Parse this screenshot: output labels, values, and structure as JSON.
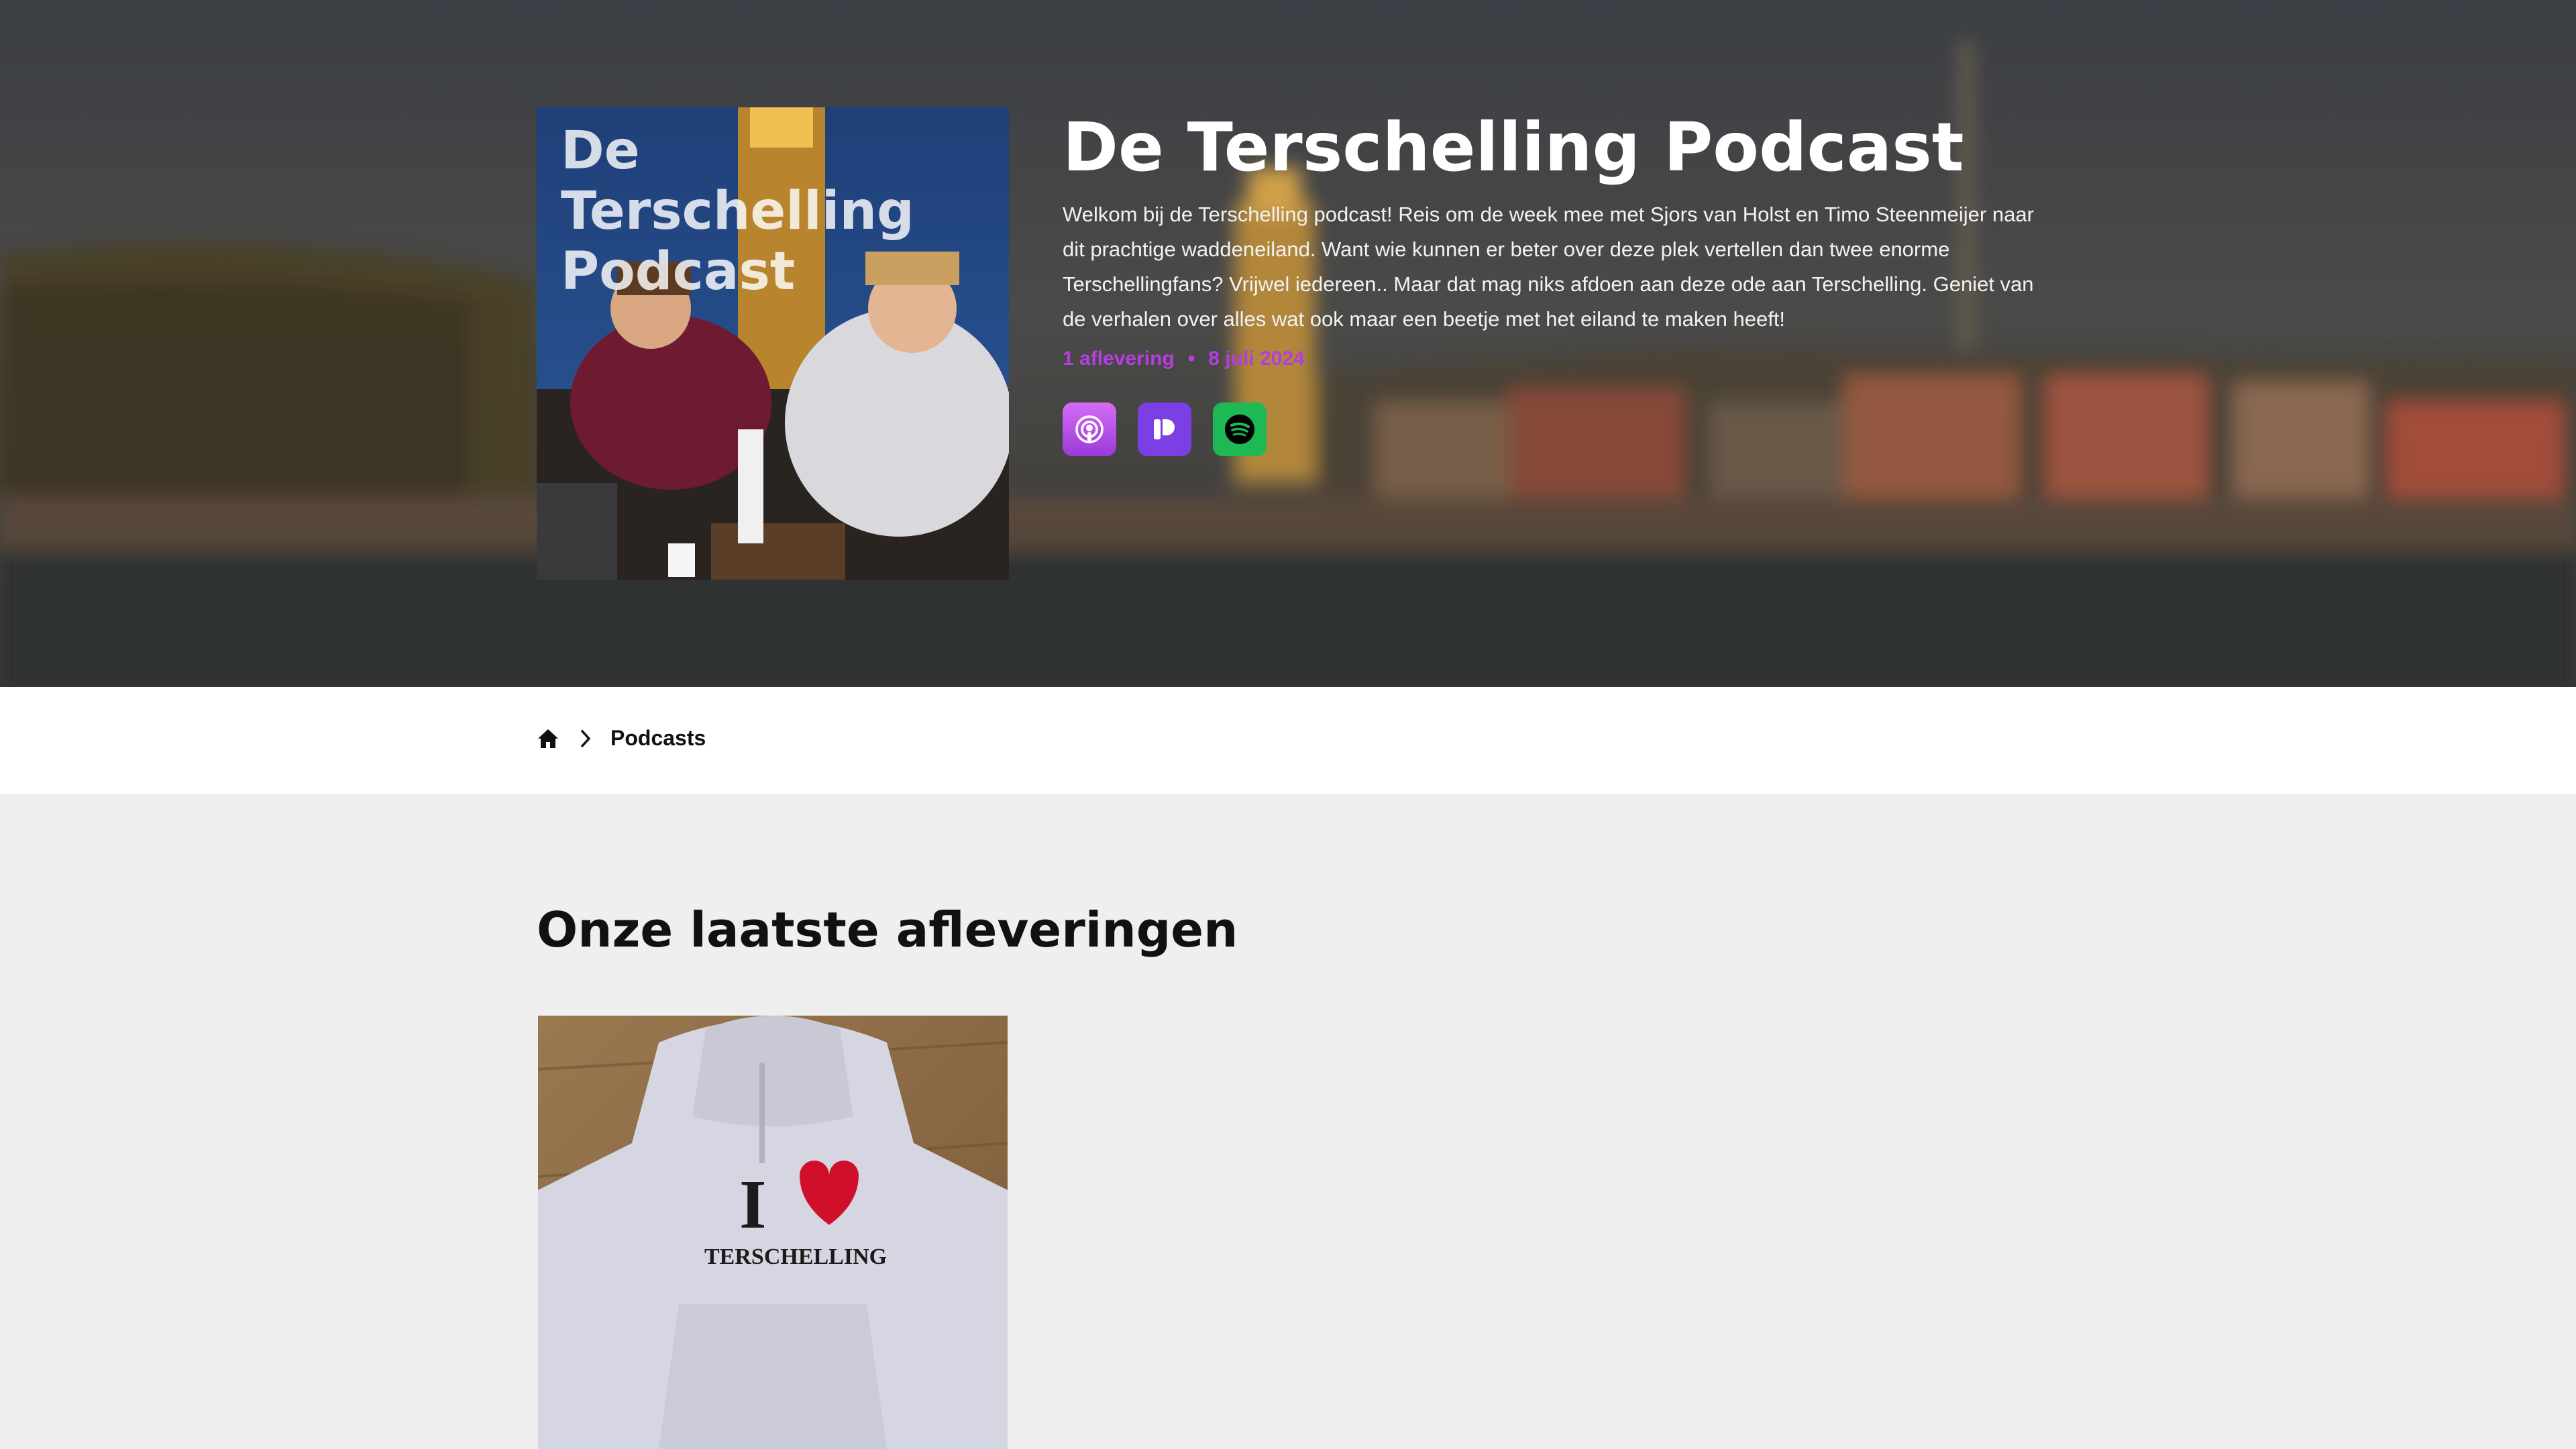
{
  "podcast": {
    "cover_title_lines": [
      "De",
      "Terschelling",
      "Podcast"
    ],
    "title": "De Terschelling Podcast",
    "description": "Welkom bij de Terschelling podcast! Reis om de week mee met Sjors van Holst en Timo Steenmeijer naar dit prachtige waddeneiland. Want wie kunnen er beter over deze plek vertellen dan twee enorme Terschellingfans? Vrijwel iedereen.. Maar dat mag niks afdoen aan deze ode aan Terschelling. Geniet van de verhalen over alles wat ook maar een beetje met het eiland te maken heeft!",
    "episode_count": "1 aflevering",
    "date": "8 juli 2024",
    "meta_separator": "•",
    "platforms": [
      {
        "name": "Apple Podcasts",
        "icon": "apple-podcasts-icon",
        "color": "#b94de8"
      },
      {
        "name": "Podimo",
        "icon": "podimo-icon",
        "color": "#7b3fe4"
      },
      {
        "name": "Spotify",
        "icon": "spotify-icon",
        "color": "#1db954"
      }
    ]
  },
  "breadcrumb": {
    "home_icon": "home-icon",
    "separator_icon": "chevron-right-icon",
    "current": "Podcasts"
  },
  "episodes_section": {
    "title": "Onze laatste afleveringen",
    "episodes": [
      {
        "image_text_top": "I",
        "image_text_bottom": "TERSCHELLING"
      }
    ]
  },
  "colors": {
    "accent": "#b53ee0",
    "page_background": "#efefef",
    "breadcrumb_background": "#ffffff"
  }
}
